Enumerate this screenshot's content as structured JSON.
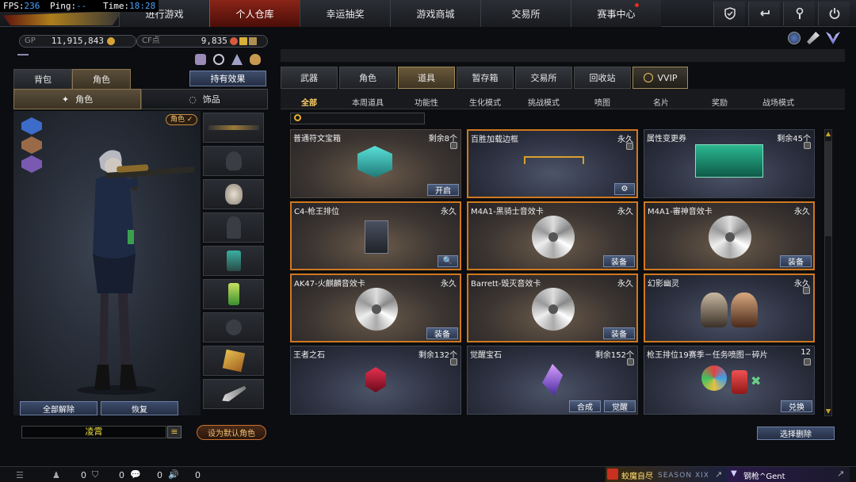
{
  "hud": {
    "fps_label": "FPS:",
    "fps": "236",
    "ping_label": "Ping:",
    "ping": "--",
    "time_label": "Time:",
    "time": "18:28"
  },
  "nav": {
    "tabs": [
      {
        "label": "进行游戏"
      },
      {
        "label": "个人仓库"
      },
      {
        "label": "幸运抽奖"
      },
      {
        "label": "游戏商城"
      },
      {
        "label": "交易所"
      },
      {
        "label": "赛事中心"
      }
    ],
    "active_index": 1
  },
  "currency": {
    "gp_label": "GP",
    "gp_value": "11,915,843",
    "cf_label": "CF点",
    "cf_value": "9,835"
  },
  "left": {
    "tabs": [
      {
        "label": "背包"
      },
      {
        "label": "角色"
      }
    ],
    "effects_button": "持有效果",
    "subtabs": [
      {
        "label": "角色"
      },
      {
        "label": "饰品"
      }
    ],
    "role_badge": "角色 ✓",
    "unequip_all": "全部解除",
    "restore": "恢复",
    "char_name": "凌霄",
    "set_default": "设为默认角色"
  },
  "right": {
    "categories": [
      {
        "label": "武器"
      },
      {
        "label": "角色"
      },
      {
        "label": "道具"
      },
      {
        "label": "暂存箱"
      },
      {
        "label": "交易所"
      },
      {
        "label": "回收站"
      },
      {
        "label": "VVIP"
      }
    ],
    "filters": [
      {
        "label": "全部"
      },
      {
        "label": "本周道具"
      },
      {
        "label": "功能性"
      },
      {
        "label": "生化模式"
      },
      {
        "label": "挑战模式"
      },
      {
        "label": "喷图"
      },
      {
        "label": "名片"
      },
      {
        "label": "奖励"
      },
      {
        "label": "战场模式"
      }
    ],
    "search_placeholder": "",
    "items": [
      {
        "name": "普通符文宝箱",
        "count": "剩余8个",
        "button": "开启"
      },
      {
        "name": "百胜加载边框",
        "count": "永久",
        "button": "⚙"
      },
      {
        "name": "属性变更券",
        "count": "剩余45个",
        "button": ""
      },
      {
        "name": "C4-枪王排位",
        "count": "永久",
        "button": "🔍"
      },
      {
        "name": "M4A1-黑骑士音效卡",
        "count": "永久",
        "button": "装备"
      },
      {
        "name": "M4A1-審神音效卡",
        "count": "永久",
        "button": "装备"
      },
      {
        "name": "AK47-火麒麟音效卡",
        "count": "永久",
        "button": "装备"
      },
      {
        "name": "Barrett-毁灭音效卡",
        "count": "永久",
        "button": "装备"
      },
      {
        "name": "幻影幽灵",
        "count": "永久",
        "button": ""
      },
      {
        "name": "王者之石",
        "count": "剩余132个",
        "button": ""
      },
      {
        "name": "觉醒宝石",
        "count": "剩余152个",
        "button": "合成",
        "button2": "觉醒"
      },
      {
        "name": "枪王排位19赛季－任务喷图－碎片",
        "count": "12",
        "button": "兑换"
      }
    ],
    "select_delete": "选择删除"
  },
  "bottom": {
    "counts": [
      "0",
      "0",
      "0",
      "0"
    ],
    "ticker1": "蛟魔自尽",
    "season": "SEASON XIX",
    "ticker2": "钢枪^Gent"
  }
}
